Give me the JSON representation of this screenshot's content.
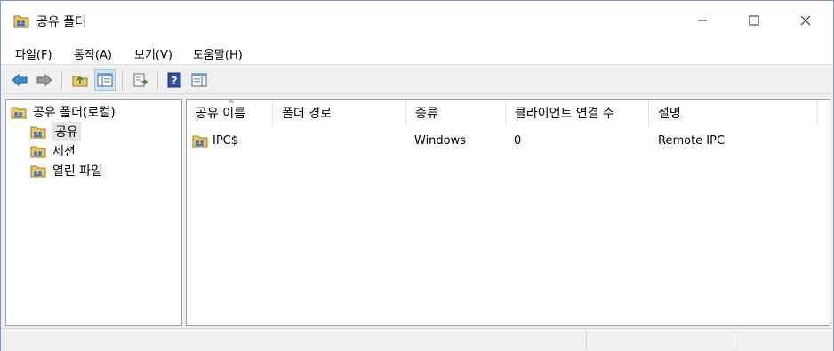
{
  "window": {
    "title": "공유 폴더"
  },
  "menu": [
    "파일(F)",
    "동작(A)",
    "보기(V)",
    "도움말(H)"
  ],
  "toolbar": {
    "buttons": [
      "back-arrow-icon",
      "forward-arrow-icon",
      "up-folder-icon",
      "show-hide-tree-icon",
      "export-list-icon",
      "help-icon",
      "show-hide-action-pane-icon"
    ]
  },
  "tree": {
    "root": "공유 폴더(로컬)",
    "items": [
      "공유",
      "세션",
      "열린 파일"
    ],
    "selected": "공유"
  },
  "list": {
    "columns": [
      "공유 이름",
      "폴더 경로",
      "종류",
      "클라이언트 연결 수",
      "설명"
    ],
    "rows": [
      {
        "name": "IPC$",
        "path": "",
        "type": "Windows",
        "connections": "0",
        "description": "Remote IPC"
      }
    ]
  },
  "colors": {
    "accent": "#1e4f8a",
    "selection": "#e5e5e5",
    "folder": "#e8c860"
  }
}
